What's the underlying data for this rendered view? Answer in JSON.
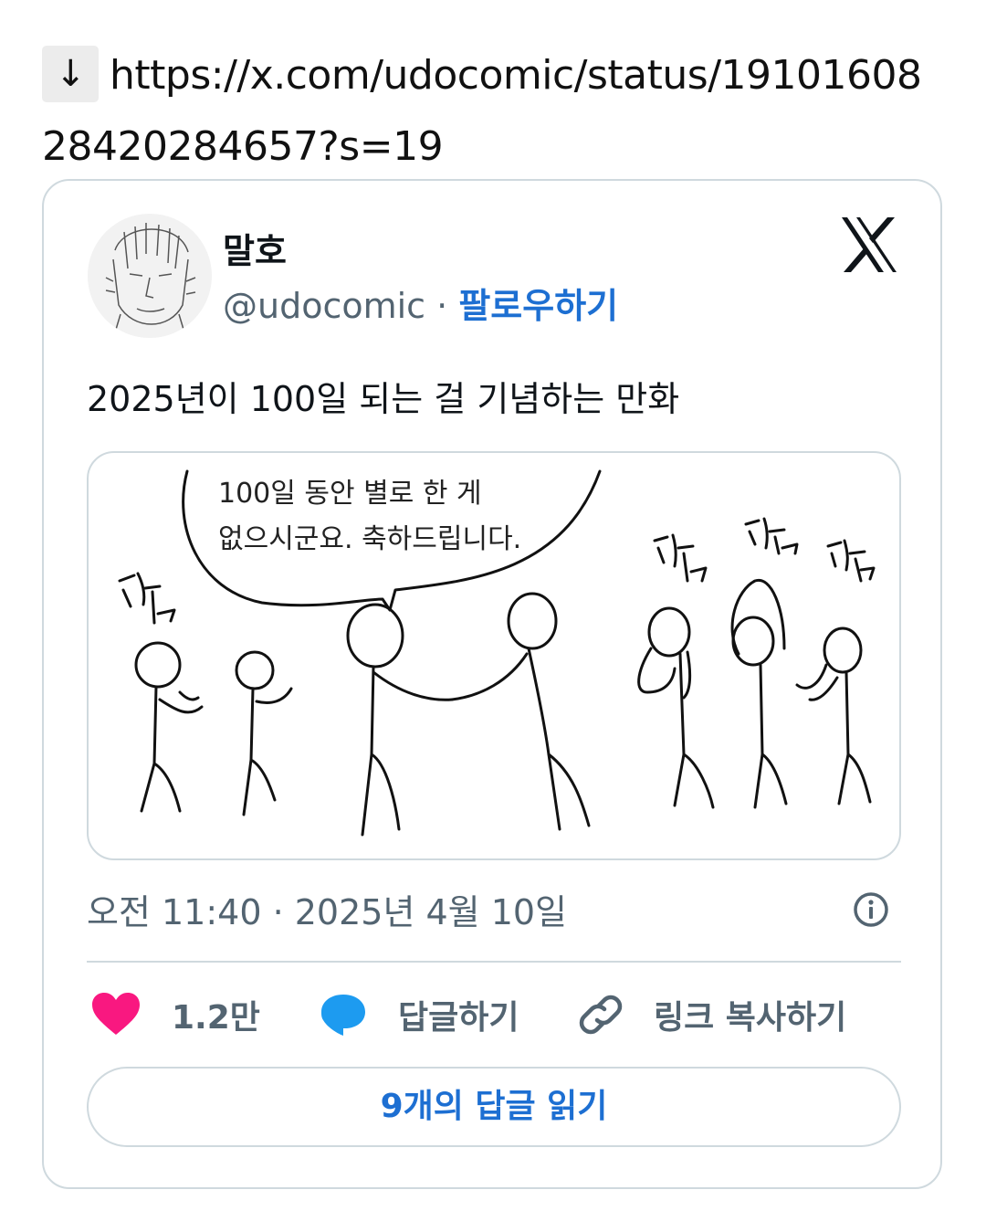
{
  "url": {
    "arrow": "↓",
    "text": "https://x.com/udocomic/status/1910160828420284657?s=19"
  },
  "tweet": {
    "author_name": "말호",
    "handle": "@udocomic",
    "separator": " · ",
    "follow_label": "팔로우하기",
    "text": "2025년이 100일 되는 걸 기념하는 만화",
    "comic": {
      "speech_line1": "100일 동안 별로 한 게",
      "speech_line2": "없으시군요. 축하드립니다.",
      "clap_text": "짝"
    },
    "timestamp": "오전 11:40 · 2025년 4월 10일",
    "actions": {
      "likes": "1.2만",
      "reply_label": "답글하기",
      "copy_link_label": "링크 복사하기"
    },
    "read_replies_label": "9개의 답글 읽기"
  },
  "colors": {
    "like": "#f91880",
    "reply": "#1d9bf0",
    "link": "#1d6fd2",
    "muted": "#536471",
    "border": "#cfd9de"
  },
  "icons": [
    "down-arrow-icon",
    "x-logo-icon",
    "info-icon",
    "heart-icon",
    "speech-bubble-icon",
    "link-icon"
  ]
}
